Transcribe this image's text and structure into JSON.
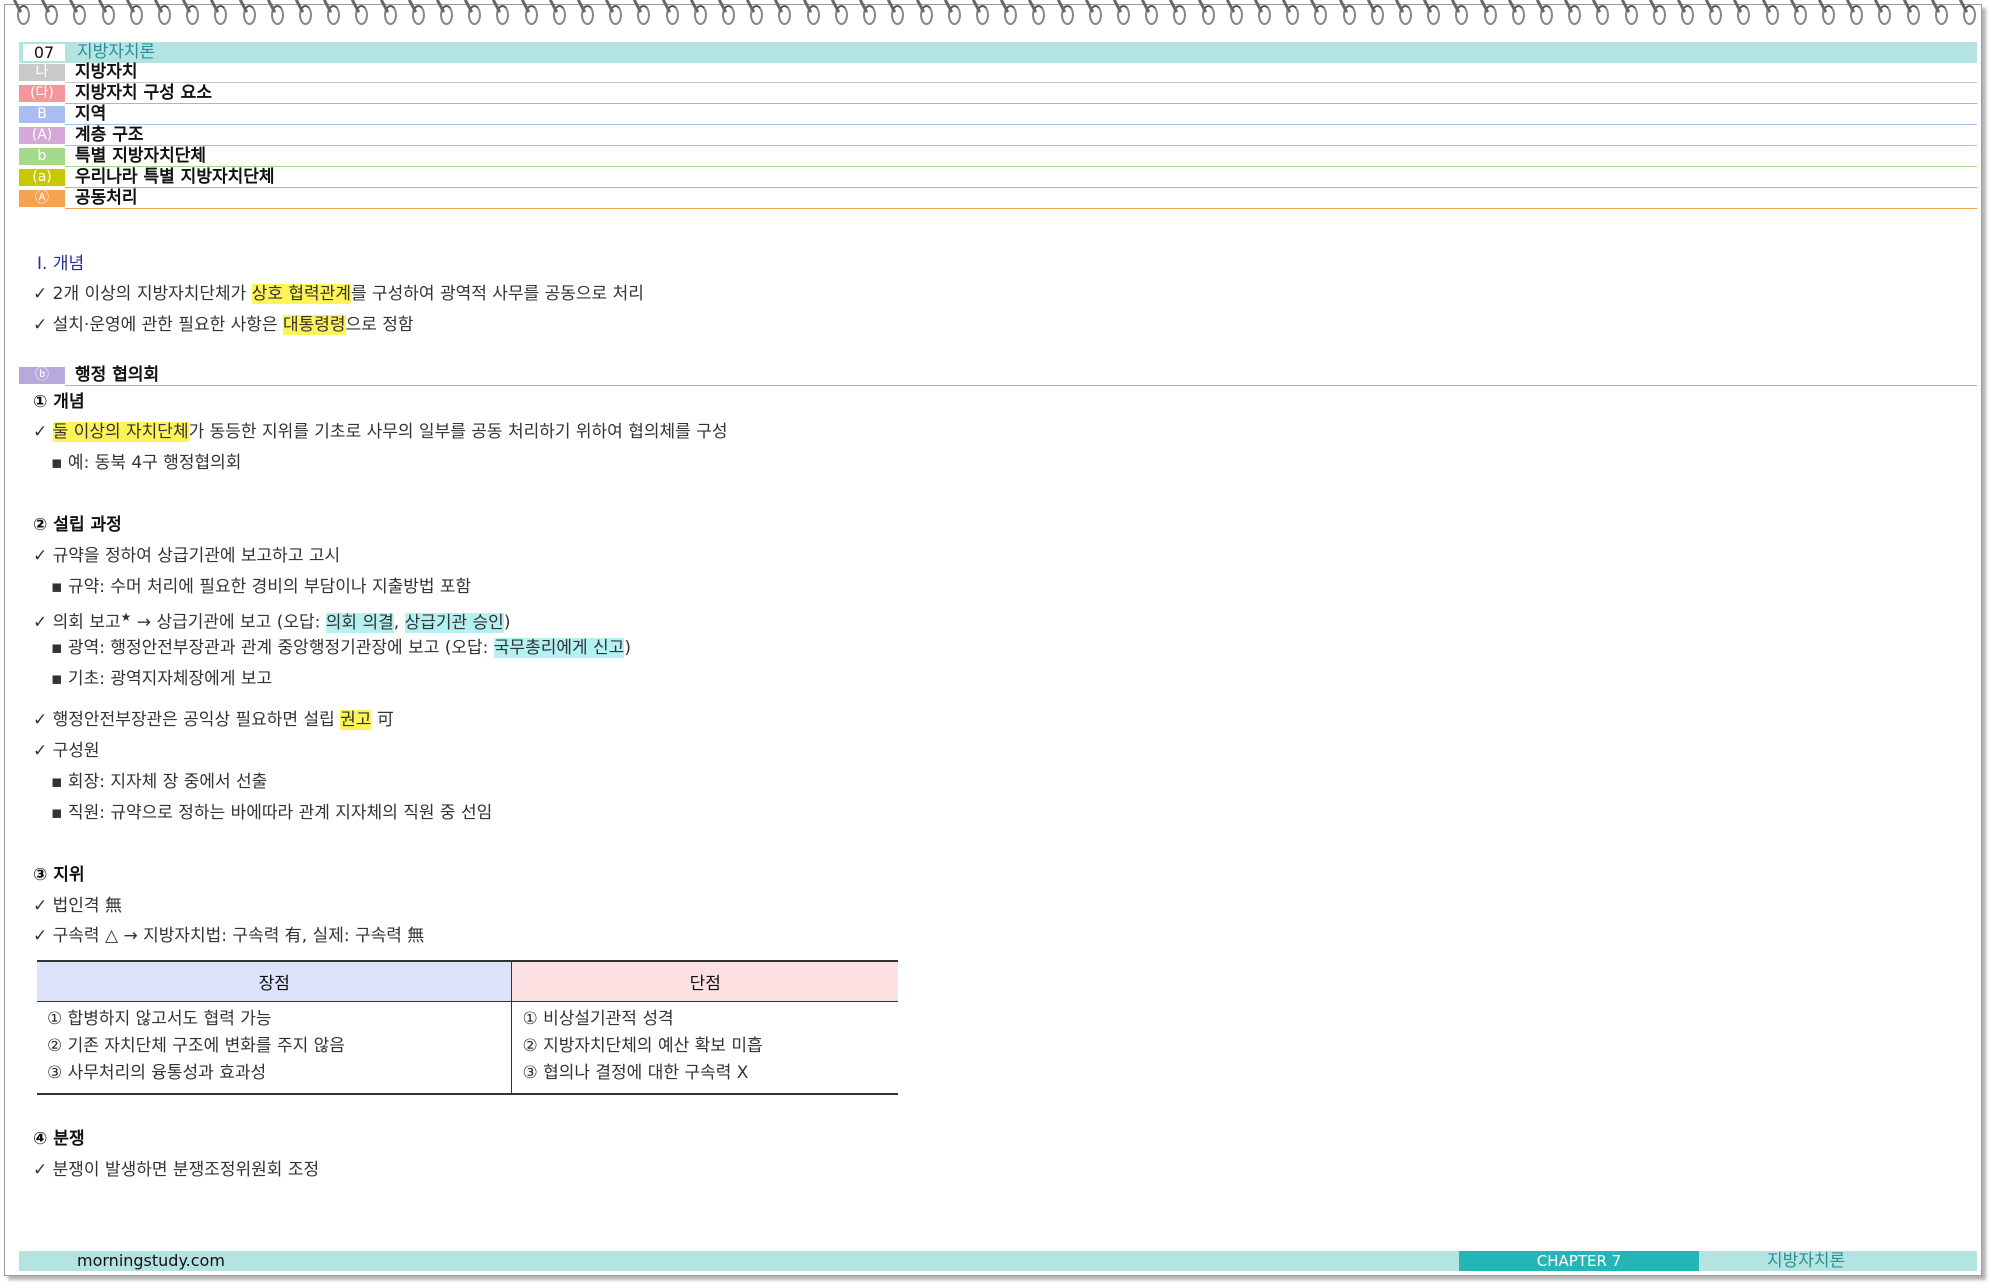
{
  "header": {
    "num": "07",
    "title": "지방자치론"
  },
  "outline": [
    {
      "tag": "나",
      "label": "지방자치",
      "tag_color": "#c9c9c9",
      "line_color": "#c9c9c9"
    },
    {
      "tag": "(다)",
      "label": "지방자치 구성 요소",
      "tag_color": "#f4969b",
      "line_color": "#f4969b"
    },
    {
      "tag": "B",
      "label": "지역",
      "tag_color": "#a9bdf2",
      "line_color": "#a9bdf2"
    },
    {
      "tag": "(A)",
      "label": "계층 구조",
      "tag_color": "#d4a9d8",
      "line_color": "#d4a9d8"
    },
    {
      "tag": "b",
      "label": "특별 지방자치단체",
      "tag_color": "#a5d98b",
      "line_color": "#a5d98b"
    },
    {
      "tag": "(a)",
      "label": "우리나라 특별 지방자치단체",
      "tag_color": "#c8c800",
      "line_color": "#c8c800"
    },
    {
      "tag": "Ⓐ",
      "label": "공동처리",
      "tag_color": "#f7a24f",
      "line_color": "#f7a24f"
    }
  ],
  "concept": {
    "title": "Ⅰ. 개념",
    "line1": {
      "pre": "✓ 2개 이상의 지방자치단체가 ",
      "hl": "상호 협력관계",
      "post": "를 구성하여 광역적 사무를 공동으로 처리"
    },
    "line2": {
      "pre": "✓ 설치·운영에 관한 필요한 사항은 ",
      "hl": "대통령령",
      "post": "으로 정함"
    }
  },
  "section_b": {
    "tag": "ⓑ",
    "label": "행정 협의회",
    "tag_color": "#b7a9db"
  },
  "s1": {
    "title": "① 개념",
    "l1": {
      "pre": "✓ ",
      "hl": "둘 이상의 자치단체",
      "post": "가 동등한 지위를 기초로 사무의 일부를 공동 처리하기 위하여 협의체를 구성"
    },
    "l2": "▪ 예: 동북 4구 행정협의회"
  },
  "s2": {
    "title": "② 설립 과정",
    "l1": "✓ 규약을 정하여 상급기관에 보고하고 고시",
    "l2": "▪ 규약: 수머 처리에 필요한 경비의 부담이나 지출방법 포함",
    "l3": {
      "pre": "✓ 의회 보고",
      "star": "★",
      "mid": " → 상급기관에 보고 (오답: ",
      "hl1": "의회 의결",
      "comma": ", ",
      "hl2": "상급기관 승인",
      "post": ")"
    },
    "l4": {
      "pre": "▪ 광역: 행정안전부장관과 관계 중앙행정기관장에 보고 (오답: ",
      "hl": "국무총리에게 신고",
      "post": ")"
    },
    "l5": "▪ 기초: 광역지자체장에게 보고",
    "l6": {
      "pre": "✓ 행정안전부장관은 공익상 필요하면 설립 ",
      "hl": "권고",
      "post": " 可"
    },
    "l7": "✓ 구성원",
    "l8": "▪ 회장: 지자체 장 중에서 선출",
    "l9": "▪ 직원: 규약으로 정하는 바에따라 관계 지자체의 직원 중 선임"
  },
  "s3": {
    "title": "③ 지위",
    "l1": "✓ 법인격 無",
    "l2": "✓ 구속력 △ → 지방자치법: 구속력 有, 실제: 구속력 無"
  },
  "table": {
    "headers": [
      "장점",
      "단점"
    ],
    "advantages": [
      "① 합병하지 않고서도 협력 가능",
      "② 기존 자치단체 구조에 변화를 주지 않음",
      "③ 사무처리의 융통성과 효과성"
    ],
    "disadvantages": [
      "① 비상설기관적 성격",
      "② 지방자치단체의 예산 확보 미흡",
      "③ 협의나 결정에 대한 구속력 X"
    ]
  },
  "s4": {
    "title": "④ 분쟁",
    "l1": "✓ 분쟁이 발생하면 분쟁조정위원회 조정"
  },
  "footer": {
    "site": "morningstudy.com",
    "chapter": "CHAPTER 7",
    "subject": "지방자치론"
  }
}
